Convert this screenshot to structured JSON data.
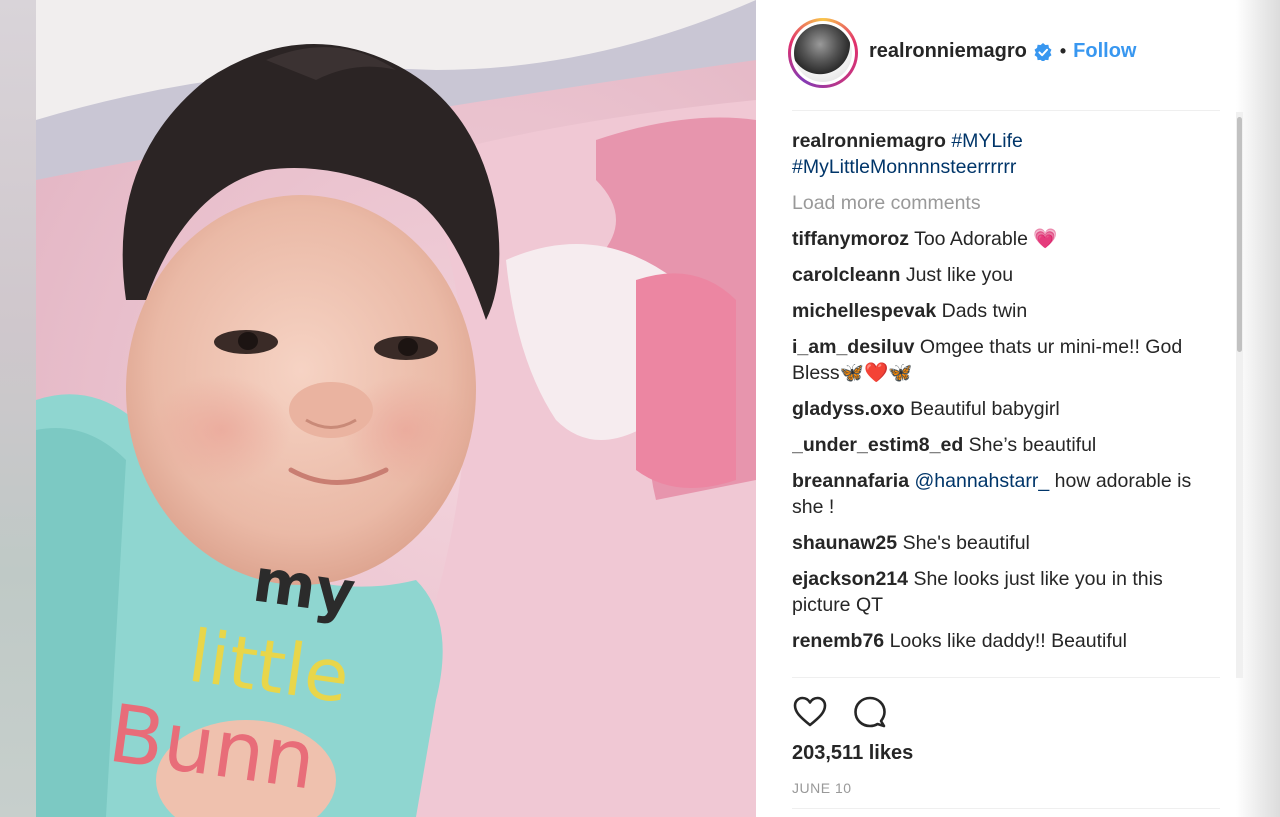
{
  "post": {
    "username": "realronniemagro",
    "follow_label": "Follow",
    "dot": "•",
    "verified_icon": "verified-badge-icon"
  },
  "caption": {
    "username": "realronniemagro",
    "tag1": "#MYLife",
    "tag2": "#MyLittleMonnnnsteerrrrrr"
  },
  "load_more": "Load more comments",
  "comments": [
    {
      "user": "tiffanymoroz",
      "text": "Too Adorable 💗"
    },
    {
      "user": "carolcleann",
      "text": "Just like you"
    },
    {
      "user": "michellespevak",
      "text": "Dads twin"
    },
    {
      "user": "i_am_desiluv",
      "text": "Omgee thats ur mini-me!! God Bless🦋❤️🦋"
    },
    {
      "user": "gladyss.oxo",
      "text": "Beautiful babygirl"
    },
    {
      "user": "_under_estim8_ed",
      "text": "She’s beautiful"
    },
    {
      "user": "breannafaria",
      "mention": "@hannahstarr_",
      "text": "how adorable is she !"
    },
    {
      "user": "shaunaw25",
      "text": "She's beautiful"
    },
    {
      "user": "ejackson214",
      "text": "She looks just like you in this picture QT"
    },
    {
      "user": "renemb76",
      "text": "Looks like daddy!! Beautiful"
    }
  ],
  "stats": {
    "likes": "203,511 likes",
    "date": "JUNE 10"
  },
  "photo_text": {
    "shirt_line1": "my",
    "shirt_line2": "little",
    "shirt_line3": "Bunn"
  },
  "colors": {
    "link": "#3897f0",
    "hashtag": "#003569",
    "verified": "#3897f0"
  }
}
